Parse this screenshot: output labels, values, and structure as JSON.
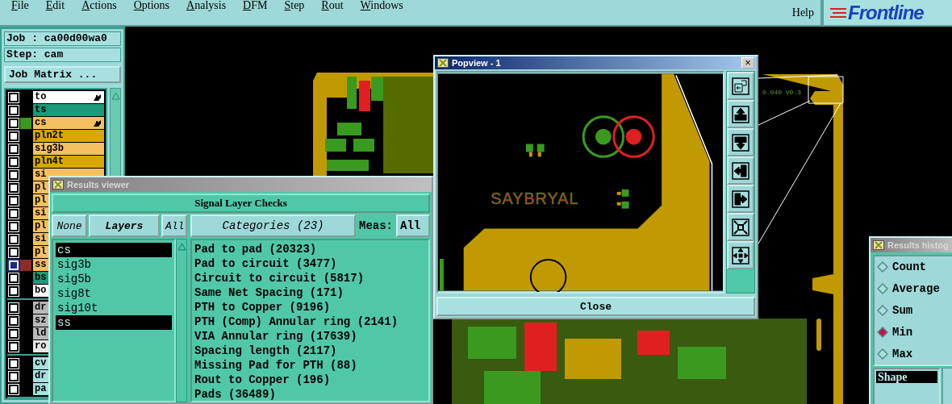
{
  "menu": {
    "items": [
      {
        "label": "File"
      },
      {
        "label": "Edit"
      },
      {
        "label": "Actions"
      },
      {
        "label": "Options"
      },
      {
        "label": "Analysis"
      },
      {
        "label": "DFM"
      },
      {
        "label": "Step"
      },
      {
        "label": "Rout"
      },
      {
        "label": "Windows"
      }
    ],
    "help": "Help",
    "logo": "Frontline"
  },
  "job_panel": {
    "job": "Job : ca00d00wa0",
    "step": "Step: cam",
    "matrix_button": "Job Matrix ...",
    "layer_groups": [
      [
        {
          "name": "to",
          "color": "#ffffff",
          "pointer": true,
          "selected": false
        },
        {
          "name": "ts",
          "color": "#1a9a78",
          "selected": false
        },
        {
          "name": "cs",
          "color": "#f5c060",
          "marker": {
            "color": "#3a9a20"
          },
          "pointer": true,
          "selected": false
        },
        {
          "name": "pln2t",
          "color": "#d8a800",
          "selected": false
        },
        {
          "name": "sig3b",
          "color": "#f5c060",
          "selected": false
        },
        {
          "name": "pln4t",
          "color": "#d8a800",
          "selected": false
        },
        {
          "name": "si",
          "color": "#f5c060",
          "selected": false
        },
        {
          "name": "pl",
          "color": "#f5c060",
          "selected": false
        },
        {
          "name": "pl",
          "color": "#f5c060",
          "selected": false
        },
        {
          "name": "si",
          "color": "#f5c060",
          "selected": false
        },
        {
          "name": "pl",
          "color": "#f5c060",
          "selected": false
        },
        {
          "name": "si",
          "color": "#f5c060",
          "selected": false
        },
        {
          "name": "pl",
          "color": "#f5c060",
          "selected": false
        },
        {
          "name": "ss",
          "color": "#f5c060",
          "marker": {
            "color": "#8e2a2a"
          },
          "selected": true
        },
        {
          "name": "bs",
          "color": "#1a9a78",
          "selected": false
        },
        {
          "name": "bo",
          "color": "#ffffff",
          "selected": false
        }
      ],
      [
        {
          "name": "dr",
          "color": "#b8b8b8",
          "selected": false
        },
        {
          "name": "sz",
          "color": "#b8b8b8",
          "selected": false
        },
        {
          "name": "ld",
          "color": "#b8b8b8",
          "selected": false
        },
        {
          "name": "ro",
          "color": "#e8e8e8",
          "selected": false
        }
      ],
      [
        {
          "name": "cv",
          "color": "#a8e0e0",
          "selected": false
        },
        {
          "name": "dr",
          "color": "#a8e0e0",
          "selected": false
        },
        {
          "name": "pa",
          "color": "#a8e0e0",
          "selected": false
        }
      ]
    ]
  },
  "board_label": "0.040 V0.3",
  "results_viewer": {
    "title": "Results viewer",
    "header": "Signal Layer Checks",
    "none_button": "None",
    "layers_button": "Layers",
    "all_button": "All",
    "categories_button": "Categories (23)",
    "meas_label": "Meas:",
    "meas_value": "All",
    "layers": [
      {
        "name": "cs",
        "selected": true
      },
      {
        "name": "sig3b",
        "selected": false
      },
      {
        "name": "sig5b",
        "selected": false
      },
      {
        "name": "sig8t",
        "selected": false
      },
      {
        "name": "sig10t",
        "selected": false
      },
      {
        "name": "ss",
        "selected": true
      }
    ],
    "categories": [
      "Pad to pad (20323)",
      "Pad to circuit (3477)",
      "Circuit to circuit (5817)",
      "Same Net Spacing (171)",
      "PTH to Copper (9196)",
      "PTH (Comp) Annular ring (2141)",
      "VIA Annular ring (17639)",
      "Spacing length (2117)",
      "Missing Pad for PTH (88)",
      "Rout to Copper (196)",
      "Pads (36489)"
    ]
  },
  "popview": {
    "title": "Popview - 1",
    "close_symbol": "×",
    "view_label": "SAYBRYAL",
    "close_button": "Close"
  },
  "histogram": {
    "title": "Results histog",
    "options": [
      {
        "label": "Count",
        "selected": false
      },
      {
        "label": "Average",
        "selected": false
      },
      {
        "label": "Sum",
        "selected": false
      },
      {
        "label": "Min",
        "selected": true
      },
      {
        "label": "Max",
        "selected": false
      }
    ],
    "list": [
      {
        "name": "Shape",
        "selected": true
      }
    ]
  }
}
